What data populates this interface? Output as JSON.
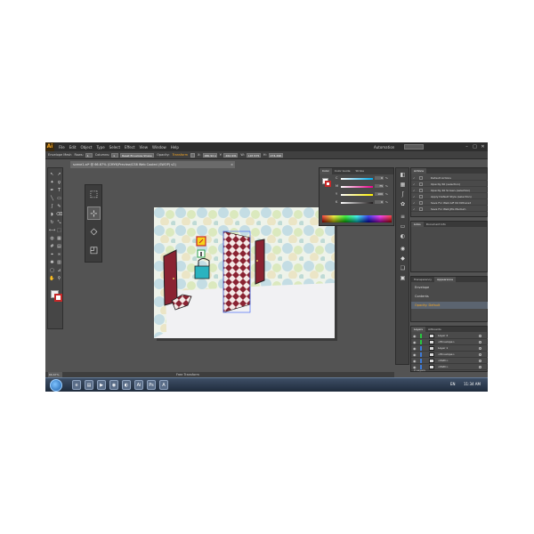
{
  "app": {
    "logo": "Ai",
    "menus": [
      "File",
      "Edit",
      "Object",
      "Type",
      "Select",
      "Effect",
      "View",
      "Window",
      "Help"
    ],
    "workspace": "Automation",
    "win_controls": [
      "–",
      "□",
      "✕"
    ]
  },
  "control_bar": {
    "label": "Envelope Mesh",
    "rows_label": "Rows:",
    "rows_value": "1",
    "columns_label": "Columns:",
    "columns_value": "1",
    "reset_label": "Reset Envelope Shape",
    "opacity_label": "Opacity:",
    "orange_label": "Transform",
    "x_label": "X:",
    "x_value": "480.94 pt",
    "y_label": "Y:",
    "y_value": "262.931 pt",
    "w_label": "W:",
    "w_value": "107.575 pt",
    "h_label": "H:",
    "h_value": "274.296 pt"
  },
  "document_tab": {
    "title": "scene1.ai* @ 66.67% (CMYK/Preview/CS6 Web Cooled (SWOP) v2)",
    "close": "×"
  },
  "tools_panel": {
    "icons": [
      "selection-icon",
      "direct-selection-icon",
      "magic-wand-icon",
      "lasso-icon",
      "pen-icon",
      "type-icon",
      "line-icon",
      "rectangle-icon",
      "paintbrush-icon",
      "pencil-icon",
      "blob-brush-icon",
      "eraser-icon",
      "rotate-icon",
      "scale-icon",
      "width-icon",
      "free-transform-icon",
      "shape-builder-icon",
      "perspective-grid-icon",
      "mesh-icon",
      "gradient-icon",
      "eyedropper-icon",
      "blend-icon",
      "symbol-sprayer-icon",
      "column-graph-icon",
      "artboard-icon",
      "slice-icon",
      "hand-icon",
      "zoom-icon"
    ],
    "glyphs": [
      "↖",
      "↗",
      "✦",
      "ϙ",
      "✒",
      "T",
      "╲",
      "▭",
      "ʃ",
      "✎",
      "◗",
      "⌫",
      "↻",
      "⤡",
      "⟷",
      "⬚",
      "◍",
      "▦",
      "#",
      "▤",
      "⌖",
      "∞",
      "✺",
      "▥",
      "▢",
      "⊿",
      "✋",
      "⚲"
    ]
  },
  "flyout": {
    "icons": [
      "free-transform-icon",
      "constrain-icon",
      "perspective-distort-icon",
      "free-distort-icon"
    ],
    "glyphs": [
      "⬚",
      "⊹",
      "◇",
      "◰"
    ]
  },
  "color_panel": {
    "tabs": [
      "Color",
      "Color Guide",
      "Stroke"
    ],
    "channels": [
      {
        "label": "C",
        "value": "0",
        "color": "#00aeef"
      },
      {
        "label": "M",
        "value": "75",
        "color": "#ec008c"
      },
      {
        "label": "Y",
        "value": "100",
        "color": "#fff200"
      },
      {
        "label": "K",
        "value": "0",
        "color": "#231f20"
      }
    ],
    "pct": "%"
  },
  "actions_panel": {
    "title": "Actions",
    "rows": [
      {
        "label": "Default Actions"
      },
      {
        "label": "Opacity 60 (selection)"
      },
      {
        "label": "Opacity 40 Screen (selection)"
      },
      {
        "label": "Apply Default Style (selection)"
      },
      {
        "label": "Save For Web GIF 64 Dithered"
      },
      {
        "label": "Save For Web JPG Medium"
      }
    ]
  },
  "links_panel": {
    "tabs": [
      "Links",
      "Document Info"
    ]
  },
  "appearance_panel": {
    "tabs": [
      "Transparency",
      "Appearance"
    ],
    "rows": [
      "Envelope",
      "Contents",
      "Opacity: Default"
    ]
  },
  "layers_panel": {
    "tabs": [
      "Layers",
      "Artboards"
    ],
    "rows": [
      {
        "name": "Layer 2",
        "color": "#27c93f"
      },
      {
        "name": "<Envelope>",
        "color": "#27c93f"
      },
      {
        "name": "Layer 1",
        "color": "#3e7bd8"
      },
      {
        "name": "<Envelope>",
        "color": "#3e7bd8"
      },
      {
        "name": "<Path>",
        "color": "#3e7bd8"
      },
      {
        "name": "<Path>",
        "color": "#3e7bd8"
      }
    ],
    "footer": "2 Layers"
  },
  "status_bar": {
    "zoom": "66.67%",
    "text": "Free Transform"
  },
  "taskbar": {
    "apps": [
      "ie-icon",
      "folder-icon",
      "media-icon",
      "chrome-icon",
      "firefox-icon",
      "illustrator-icon",
      "photoshop-icon",
      "acrobat-icon"
    ],
    "app_glyphs": [
      "e",
      "▤",
      "▶",
      "◉",
      "◐",
      "Ai",
      "Ps",
      "A"
    ],
    "lang": "EN",
    "time": "11:34 AM"
  },
  "colors": {
    "brand_orange": "#f5a623",
    "selection_blue": "#4a6cf7",
    "door_red": "#8a2332"
  }
}
